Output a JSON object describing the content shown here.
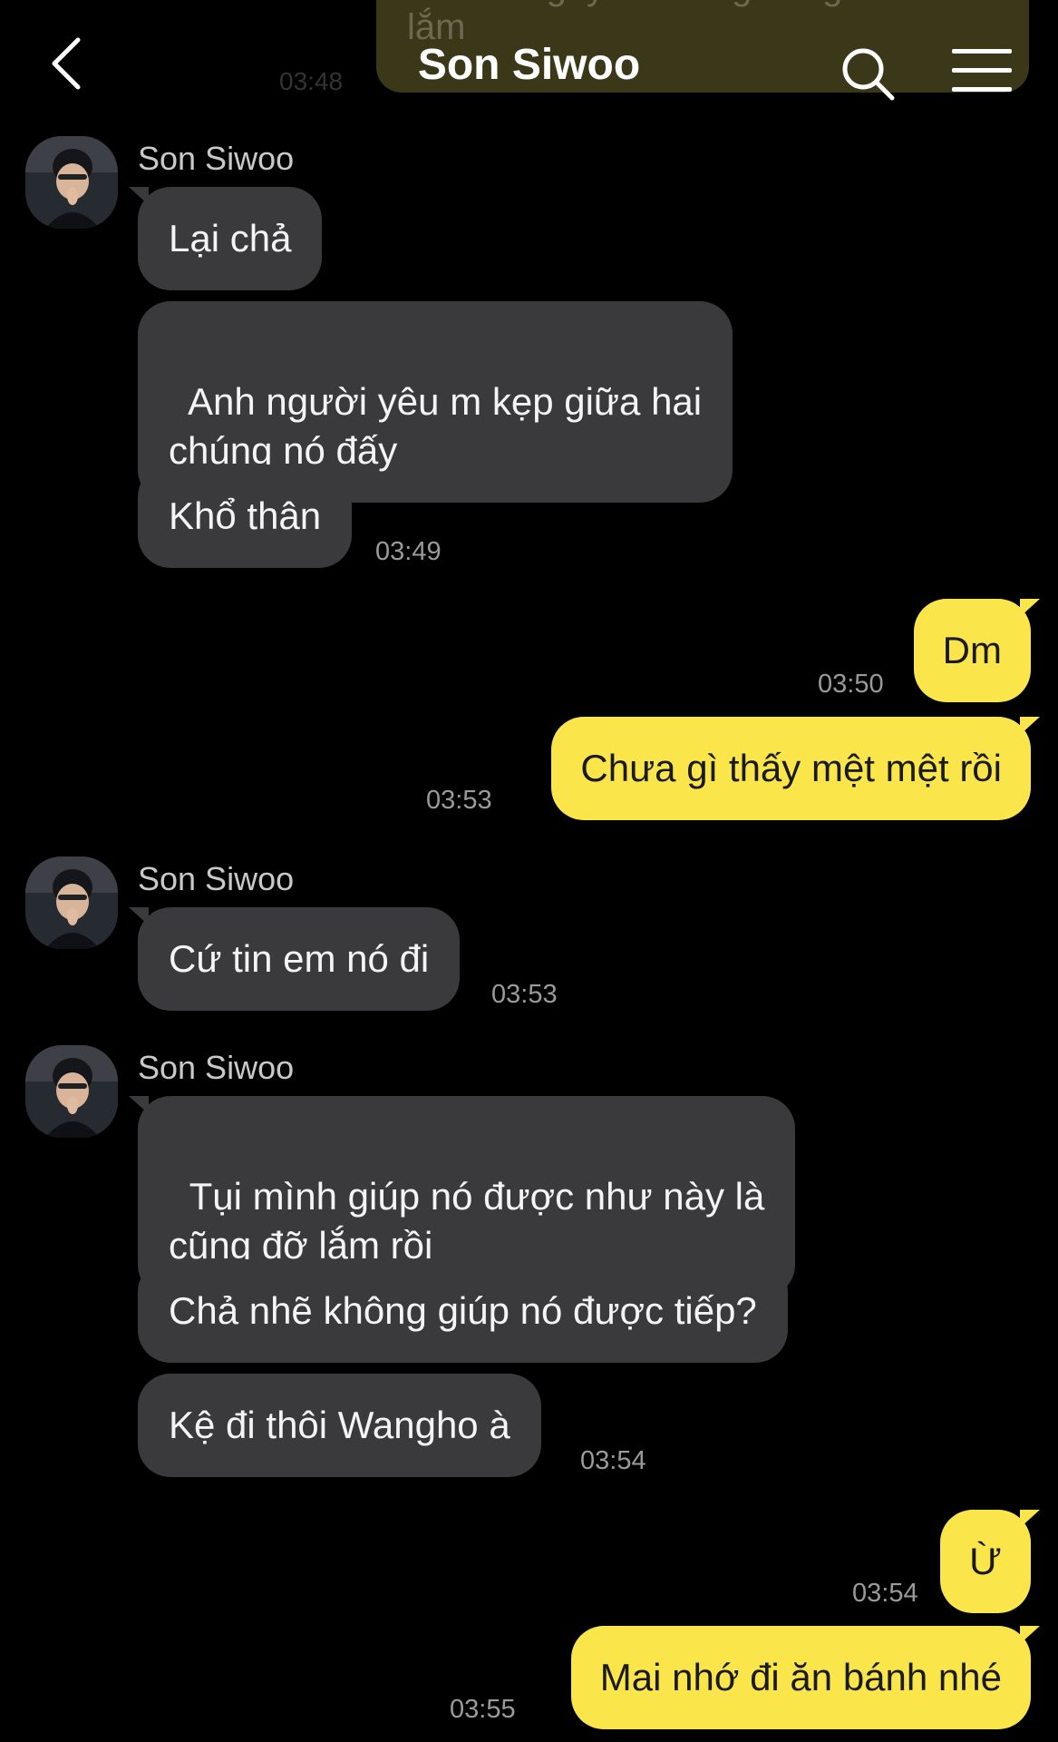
{
  "header": {
    "title": "Son Siwoo",
    "back_icon": "chevron-left-icon",
    "search_icon": "search-icon",
    "menu_icon": "hamburger-menu-icon"
  },
  "ghost": {
    "text": "Anh Sanghyeok cũng đang diễn đều lắm",
    "time": "03:48"
  },
  "groups": [
    {
      "sender": "Son Siwoo",
      "messages": [
        "Lại chả",
        "Anh người yêu m kẹp giữa hai\nchúng nó đấy",
        "Khổ thân"
      ],
      "time": "03:49"
    },
    {
      "me": "Dm",
      "time": "03:50"
    },
    {
      "me": "Chưa gì thấy mệt mệt rồi",
      "time": "03:53"
    },
    {
      "sender": "Son Siwoo",
      "messages": [
        "Cứ tin em nó đi"
      ],
      "time": "03:53"
    },
    {
      "sender": "Son Siwoo",
      "messages": [
        "Tụi mình giúp nó được như này là\ncũng đỡ lắm rồi",
        "Chả nhẽ không giúp nó được tiếp?",
        "Kệ đi thôi Wangho à"
      ],
      "time": "03:54"
    },
    {
      "me": "Ừ",
      "time": "03:54"
    },
    {
      "me": "Mai nhớ đi ăn bánh nhé",
      "time": "03:55"
    }
  ],
  "colors": {
    "background": "#000000",
    "incoming_bubble": "#3a3a3c",
    "outgoing_bubble": "#fae64a",
    "timestamp": "#9a9a9a"
  }
}
